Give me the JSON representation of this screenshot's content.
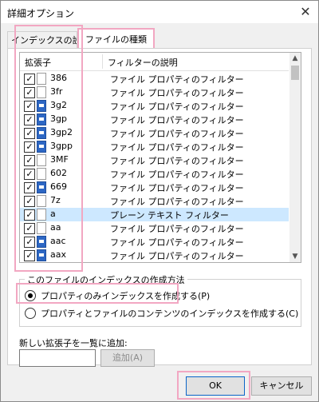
{
  "window": {
    "title": "詳細オプション",
    "close": "✕"
  },
  "tabs": [
    {
      "label": "インデックスの設定"
    },
    {
      "label": "ファイルの種類"
    }
  ],
  "list": {
    "columns": {
      "ext": "拡張子",
      "desc": "フィルターの説明"
    },
    "rows": [
      {
        "ext": "386",
        "desc": "ファイル プロパティのフィルター",
        "icon": "gear-file-icon",
        "checked": true,
        "selected": false
      },
      {
        "ext": "3fr",
        "desc": "ファイル プロパティのフィルター",
        "icon": "file-icon",
        "checked": true,
        "selected": false
      },
      {
        "ext": "3g2",
        "desc": "ファイル プロパティのフィルター",
        "icon": "media-file-icon",
        "checked": true,
        "selected": false
      },
      {
        "ext": "3gp",
        "desc": "ファイル プロパティのフィルター",
        "icon": "media-file-icon",
        "checked": true,
        "selected": false
      },
      {
        "ext": "3gp2",
        "desc": "ファイル プロパティのフィルター",
        "icon": "media-file-icon",
        "checked": true,
        "selected": false
      },
      {
        "ext": "3gpp",
        "desc": "ファイル プロパティのフィルター",
        "icon": "media-file-icon",
        "checked": true,
        "selected": false
      },
      {
        "ext": "3MF",
        "desc": "ファイル プロパティのフィルター",
        "icon": "file-icon",
        "checked": true,
        "selected": false
      },
      {
        "ext": "602",
        "desc": "ファイル プロパティのフィルター",
        "icon": "file-icon",
        "checked": true,
        "selected": false
      },
      {
        "ext": "669",
        "desc": "ファイル プロパティのフィルター",
        "icon": "audio-file-icon",
        "checked": true,
        "selected": false
      },
      {
        "ext": "7z",
        "desc": "ファイル プロパティのフィルター",
        "icon": "file-icon",
        "checked": true,
        "selected": false
      },
      {
        "ext": "a",
        "desc": "プレーン テキスト フィルター",
        "icon": "file-icon",
        "checked": true,
        "selected": true
      },
      {
        "ext": "aa",
        "desc": "ファイル プロパティのフィルター",
        "icon": "file-icon",
        "checked": true,
        "selected": false
      },
      {
        "ext": "aac",
        "desc": "ファイル プロパティのフィルター",
        "icon": "media-file-icon",
        "checked": true,
        "selected": false
      },
      {
        "ext": "aax",
        "desc": "ファイル プロパティのフィルター",
        "icon": "media-file-icon",
        "checked": true,
        "selected": false
      }
    ]
  },
  "index_method": {
    "title": "このファイルのインデックスの作成方法",
    "options": [
      {
        "label": "プロパティのみインデックスを作成する(P)",
        "selected": true
      },
      {
        "label": "プロパティとファイルのコンテンツのインデックスを作成する(C)",
        "selected": false
      }
    ]
  },
  "add_extension": {
    "label": "新しい拡張子を一覧に追加:",
    "value": "",
    "button": "追加(A)"
  },
  "footer": {
    "ok": "OK",
    "cancel": "キャンセル"
  },
  "colors": {
    "highlight": "#f2a7c2",
    "selection": "#cde8ff",
    "accent": "#0a64c8"
  }
}
